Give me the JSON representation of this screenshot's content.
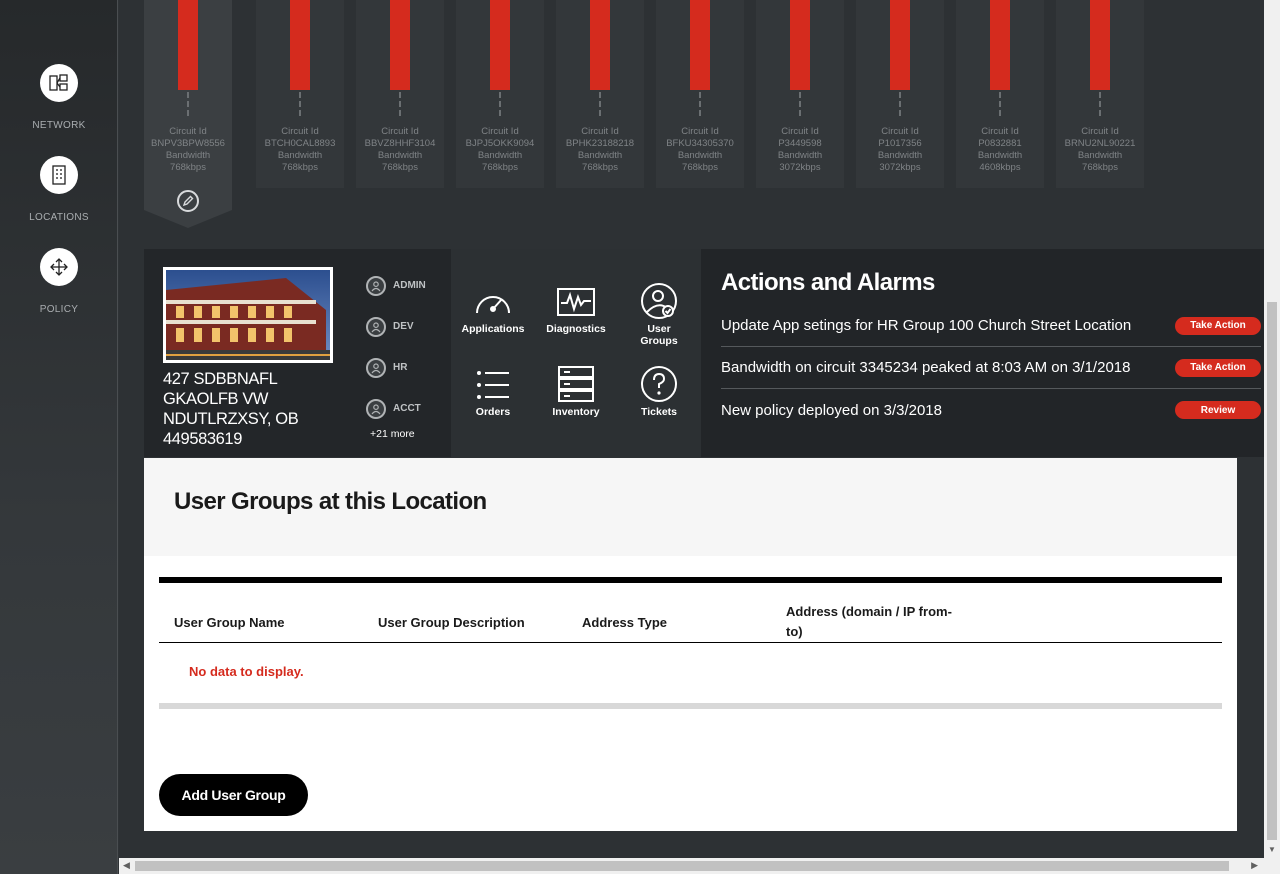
{
  "sidebar": {
    "items": [
      {
        "label": "NETWORK",
        "icon": "network-icon"
      },
      {
        "label": "LOCATIONS",
        "icon": "building-icon"
      },
      {
        "label": "POLICY",
        "icon": "move-arrows-icon"
      }
    ]
  },
  "circuits": [
    {
      "id_label": "Circuit Id",
      "id": "BNPV3BPW8556",
      "bw_label": "Bandwidth",
      "bw": "768kbps"
    },
    {
      "id_label": "Circuit Id",
      "id": "BTCH0CAL8893",
      "bw_label": "Bandwidth",
      "bw": "768kbps"
    },
    {
      "id_label": "Circuit Id",
      "id": "BBVZ8HHF3104",
      "bw_label": "Bandwidth",
      "bw": "768kbps"
    },
    {
      "id_label": "Circuit Id",
      "id": "BJPJ5OKK9094",
      "bw_label": "Bandwidth",
      "bw": "768kbps"
    },
    {
      "id_label": "Circuit Id",
      "id": "BPHK23188218",
      "bw_label": "Bandwidth",
      "bw": "768kbps"
    },
    {
      "id_label": "Circuit Id",
      "id": "BFKU34305370",
      "bw_label": "Bandwidth",
      "bw": "768kbps"
    },
    {
      "id_label": "Circuit Id",
      "id": "P3449598",
      "bw_label": "Bandwidth",
      "bw": "3072kbps"
    },
    {
      "id_label": "Circuit Id",
      "id": "P1017356",
      "bw_label": "Bandwidth",
      "bw": "3072kbps"
    },
    {
      "id_label": "Circuit Id",
      "id": "P0832881",
      "bw_label": "Bandwidth",
      "bw": "4608kbps"
    },
    {
      "id_label": "Circuit Id",
      "id": "BRNU2NL90221",
      "bw_label": "Bandwidth",
      "bw": "768kbps"
    }
  ],
  "location": {
    "address_lines": [
      "427 SDBBNAFL",
      "GKAOLFB VW",
      "NDUTLRZXSY, OB",
      "449583619"
    ],
    "roles": [
      "ADMIN",
      "DEV",
      "HR",
      "ACCT"
    ],
    "more": "+21 more",
    "tiles": {
      "applications": "Applications",
      "diagnostics": "Diagnostics",
      "user_groups_1": "User",
      "user_groups_2": "Groups",
      "orders": "Orders",
      "inventory": "Inventory",
      "tickets": "Tickets"
    }
  },
  "actions": {
    "title": "Actions and Alarms",
    "rows": [
      {
        "text": "Update App setings for HR Group 100 Church Street Location",
        "button": "Take Action"
      },
      {
        "text": "Bandwidth on circuit 3345234 peaked at 8:03 AM on 3/1/2018",
        "button": "Take Action"
      },
      {
        "text": "New policy deployed on 3/3/2018",
        "button": "Review"
      }
    ]
  },
  "user_groups": {
    "title": "User Groups at this Location",
    "columns": [
      "User Group Name",
      "User Group Description",
      "Address Type",
      "Address (domain / IP from-to)"
    ],
    "col_addr_line1": "Address (domain / IP from-",
    "col_addr_line2": "to)",
    "empty_message": "No data to display.",
    "add_button": "Add User Group"
  },
  "colors": {
    "accent": "#d52b1e",
    "dark_panel": "#232629",
    "background": "#2d3134"
  }
}
